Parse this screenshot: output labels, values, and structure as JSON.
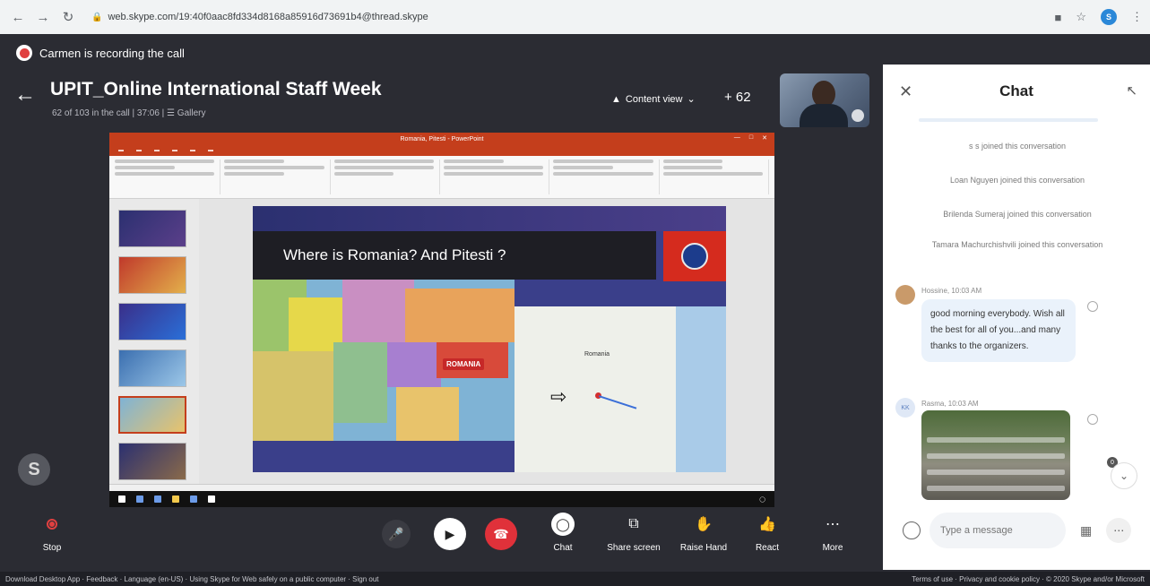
{
  "browser": {
    "url": "web.skype.com/19:40f0aac8fd334d8168a85916d73691b4@thread.skype"
  },
  "recording_banner": {
    "text": "Carmen is recording the call"
  },
  "call": {
    "title": "UPIT_Online International Staff Week",
    "subtitle": "62 of 103 in the call | 37:06 | ☰ Gallery",
    "content_view_label": "Content view",
    "participants_more": "+ 62"
  },
  "presentation": {
    "window_title": "Romania, Pitesti - PowerPoint",
    "slide_title": "Where is Romania? And Pitesti ?",
    "map_label_romania": "ROMANIA",
    "map_label_region": "Romania"
  },
  "controls": {
    "stop_label": "Stop",
    "chat_label": "Chat",
    "share_label": "Share screen",
    "raise_hand_label": "Raise Hand",
    "react_label": "React",
    "more_label": "More"
  },
  "footer": {
    "left": "Download Desktop App  ·  Feedback  ·  Language (en-US)  ·  Using Skype for Web safely on a public computer  ·  Sign out",
    "right": "Terms of use  ·  Privacy and cookie policy  ·  © 2020 Skype and/or Microsoft"
  },
  "chat": {
    "title": "Chat",
    "system_messages": [
      "s s joined this conversation",
      "Loan Nguyen joined this conversation",
      "Brilenda Sumeraj joined this conversation",
      "Tamara Machurchishvili joined this conversation"
    ],
    "messages": [
      {
        "sender": "Hossine, 10:03 AM",
        "text": "good morning everybody. Wish all the best for all of you...and many thanks to the organizers."
      },
      {
        "sender": "Rasma, 10:03 AM",
        "avatar_initials": "KK"
      }
    ],
    "compose_placeholder": "Type a message",
    "unread_badge": "0"
  }
}
